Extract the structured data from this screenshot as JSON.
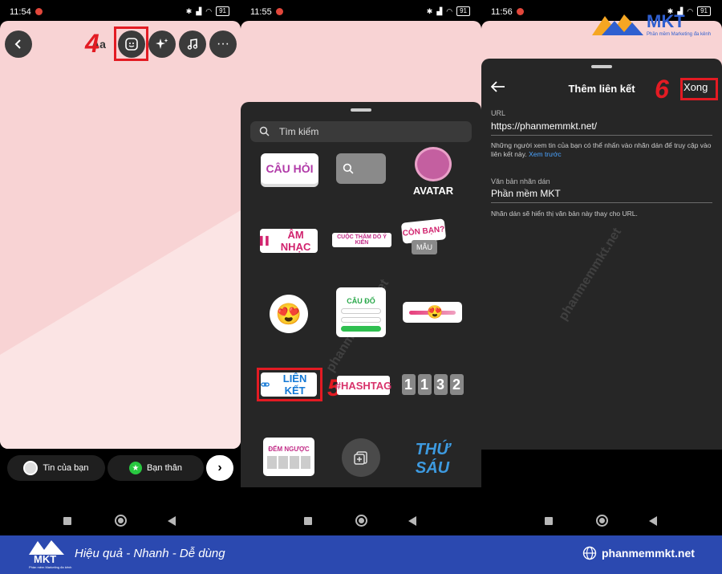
{
  "panel1": {
    "status": {
      "time": "11:54",
      "battery": "91"
    },
    "top_icons": [
      "back-icon",
      "text-aa-icon",
      "sticker-icon",
      "sparkle-effects-icon",
      "music-icon",
      "more-icon"
    ],
    "text_btn": "Aa",
    "step": "4",
    "share": {
      "your_story": "Tin của bạn",
      "close_friends": "Bạn thân"
    }
  },
  "panel2": {
    "status": {
      "time": "11:55",
      "battery": "91"
    },
    "search_placeholder": "Tìm kiếm",
    "stickers": {
      "question": "CÂU HỎI",
      "avatar": "AVATAR",
      "music": "ÂM NHẠC",
      "poll": "CUỘC THĂM DÒ Ý KIẾN",
      "your_turn": "CÒN BẠN?",
      "template": "MẪU",
      "quiz": "CÂU ĐỐ",
      "link": "LIÊN KẾT",
      "hashtag": "#HASHTAG",
      "time": [
        "1",
        "1",
        "3",
        "2"
      ],
      "countdown": "ĐẾM NGƯỢC",
      "day": "THỨ SÁU"
    },
    "step": "5"
  },
  "panel3": {
    "status": {
      "time": "11:56",
      "battery": "91"
    },
    "title": "Thêm liên kết",
    "done": "Xong",
    "step": "6",
    "url_label": "URL",
    "url_value": "https://phanmemmkt.net/",
    "url_help": "Những người xem tin của bạn có thể nhấn vào nhãn dán để truy cập vào liên kết này.",
    "url_help_link": "Xem trước",
    "text_label": "Văn bản nhãn dán",
    "text_value": "Phần mềm MKT",
    "text_help": "Nhãn dán sẽ hiển thị văn bản này thay cho URL."
  },
  "logo": {
    "name": "MKT",
    "tagline": "Phần mềm Marketing đa kênh"
  },
  "watermark": "phanmemmkt.net",
  "footer": {
    "brand": "MKT",
    "brand_sub": "Phần mềm Marketing đa kênh",
    "slogan": "Hiệu quả - Nhanh - Dễ dùng",
    "website": "phanmemmkt.net"
  },
  "colors": {
    "highlight": "#e31b23",
    "footer_bg": "#2b49b0",
    "canvas_pink": "#f8d3d4",
    "sheet": "#262626",
    "link_blue": "#4aa3ff"
  }
}
